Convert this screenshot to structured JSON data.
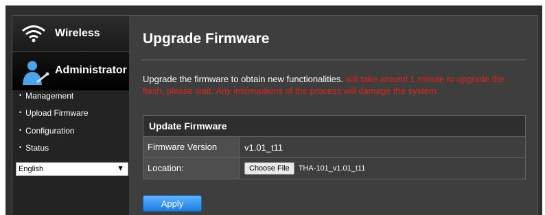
{
  "sidebar": {
    "wireless_label": "Wireless",
    "admin_label": "Administrator",
    "items": [
      {
        "label": "Management"
      },
      {
        "label": "Upload Firmware"
      },
      {
        "label": "Configuration"
      },
      {
        "label": "Status"
      }
    ],
    "language": "English"
  },
  "main": {
    "title": "Upgrade Firmware",
    "description": "Upgrade the firmware to obtain new functionalities.",
    "warning": " will take around 1 minute to upgrade   the flash, please wait. Any interruptions of the process will damage the system.",
    "table": {
      "header": "Update Firmware",
      "version_label": "Firmware Version",
      "version_value": "v1.01_t11",
      "location_label": "Location:",
      "choose_button": "Choose File",
      "file_name": "THA-101_v1.01_t11"
    },
    "apply_label": "Apply"
  },
  "colors": {
    "warning": "#e2231a",
    "accent": "#1a7fe0"
  }
}
